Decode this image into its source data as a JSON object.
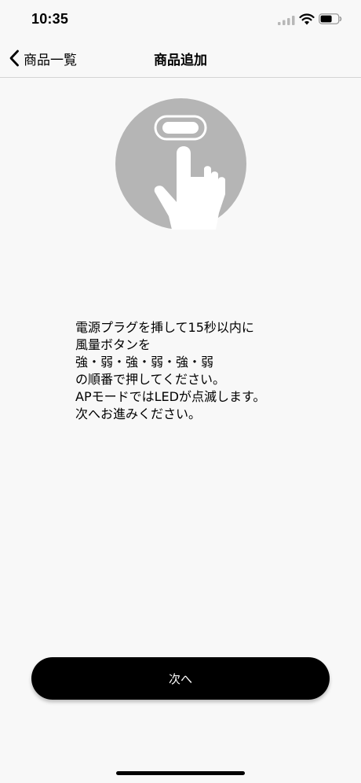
{
  "status_bar": {
    "time": "10:35"
  },
  "nav": {
    "back_label": "商品一覧",
    "title": "商品追加"
  },
  "illustration": {
    "icon": "press-button-hand-icon",
    "circle_color": "#b5b5b5"
  },
  "instructions": {
    "lines": [
      "電源プラグを挿して15秒以内に",
      "風量ボタンを",
      "強・弱・強・弱・強・弱",
      "の順番で押してください。",
      "APモードではLEDが点滅します。",
      "次へお進みください。"
    ]
  },
  "footer": {
    "next_label": "次へ"
  },
  "colors": {
    "background": "#f8f8f8",
    "button": "#000000",
    "button_text": "#ffffff"
  }
}
